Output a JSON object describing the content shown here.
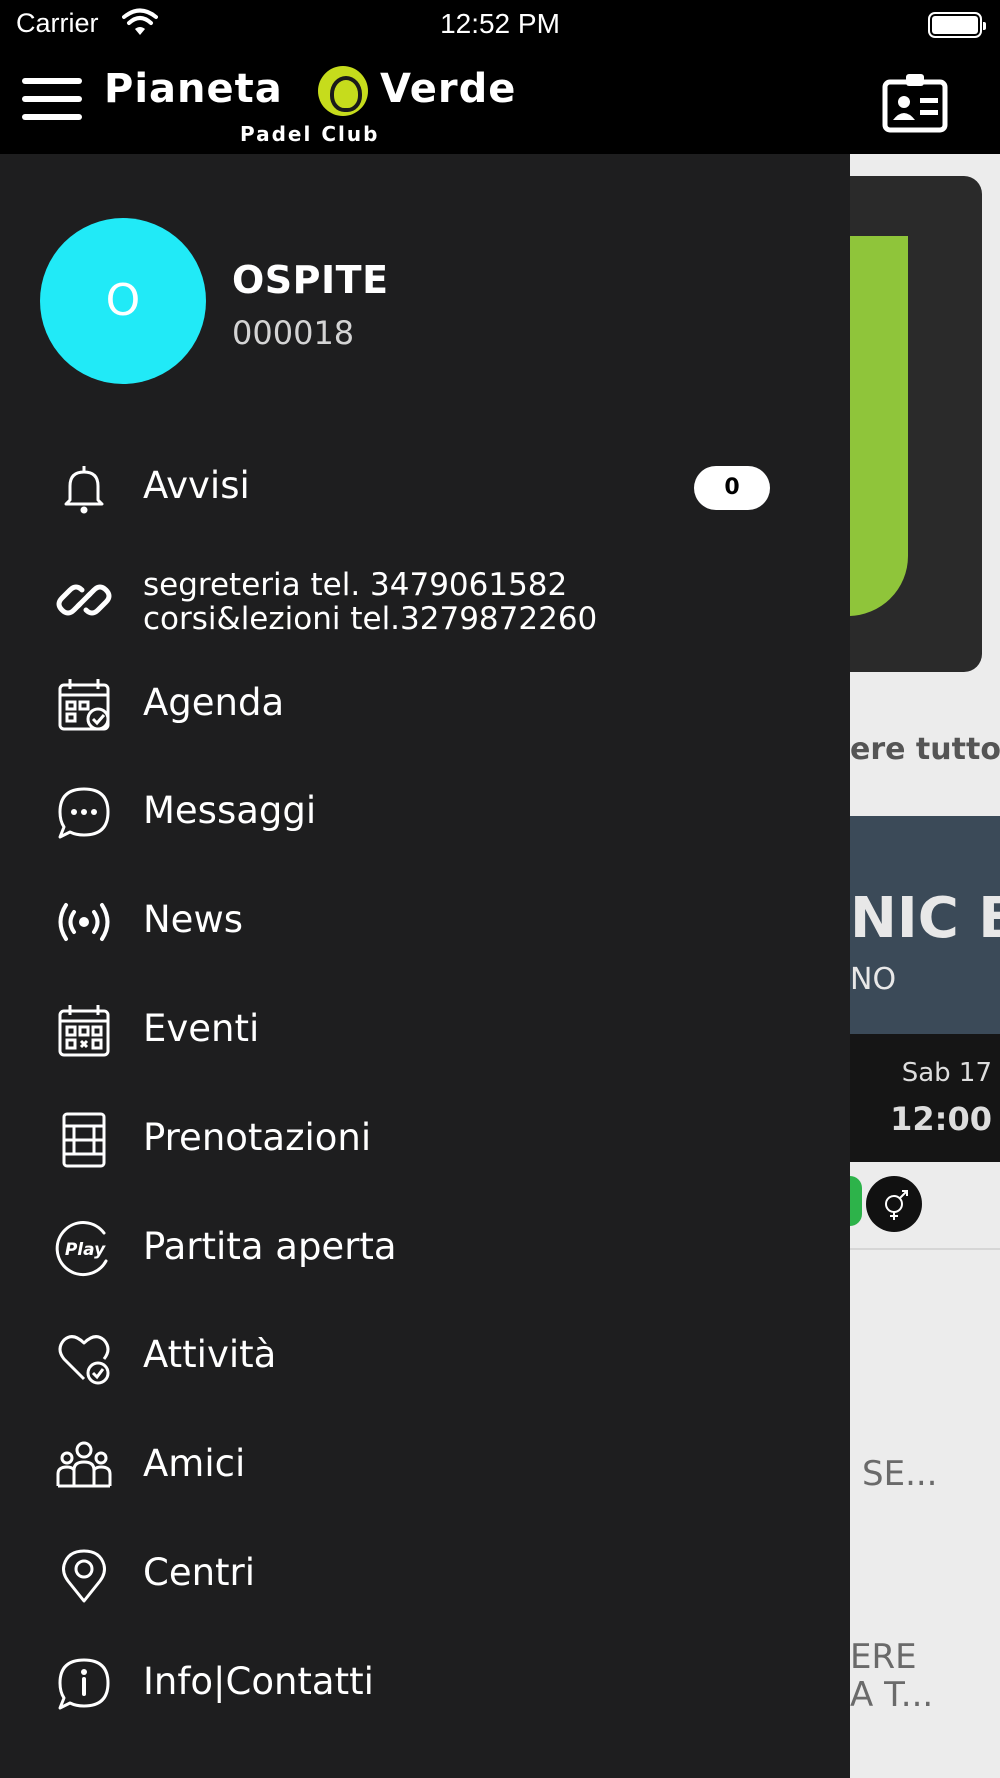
{
  "status_bar": {
    "carrier": "Carrier",
    "time": "12:52 PM",
    "icons": [
      "wifi-icon",
      "battery-icon"
    ]
  },
  "header": {
    "logo": {
      "left": "Pianeta",
      "right": "Verde",
      "subtitle": "Padel Club"
    },
    "icons": [
      "hamburger-menu-icon",
      "contact-card-icon"
    ]
  },
  "profile": {
    "initial": "O",
    "name": "OSPITE",
    "code": "000018",
    "avatar_color": "#21eaf7"
  },
  "menu": [
    {
      "label": "Avvisi",
      "icon": "bell-icon",
      "badge": "0"
    },
    {
      "line1": "segreteria tel. 3479061582",
      "line2": "corsi&lezioni tel.3279872260",
      "icon": "link-icon"
    },
    {
      "label": "Agenda",
      "icon": "calendar-check-icon"
    },
    {
      "label": "Messaggi",
      "icon": "chat-bubble-icon"
    },
    {
      "label": "News",
      "icon": "broadcast-icon"
    },
    {
      "label": "Eventi",
      "icon": "calendar-grid-icon"
    },
    {
      "label": "Prenotazioni",
      "icon": "court-icon"
    },
    {
      "label": "Partita aperta",
      "icon": "play-icon"
    },
    {
      "label": "Attività",
      "icon": "heart-check-icon"
    },
    {
      "label": "Amici",
      "icon": "people-icon"
    },
    {
      "label": "Centri",
      "icon": "map-pin-icon"
    },
    {
      "label": "Info|Contatti",
      "icon": "info-chat-icon"
    }
  ],
  "background": {
    "see_all": "ere tutto",
    "event_title": "NIC B",
    "event_subtitle": "NO",
    "event_day": "Sab 17",
    "event_time": "12:00",
    "text1": "SE...",
    "text2_line1": "ERE",
    "text2_line2": "A T..."
  },
  "colors": {
    "drawer_bg": "#1e1e1f",
    "header_bg": "#000000",
    "logo_accent": "#c6dc1c",
    "avatar": "#21eaf7"
  }
}
